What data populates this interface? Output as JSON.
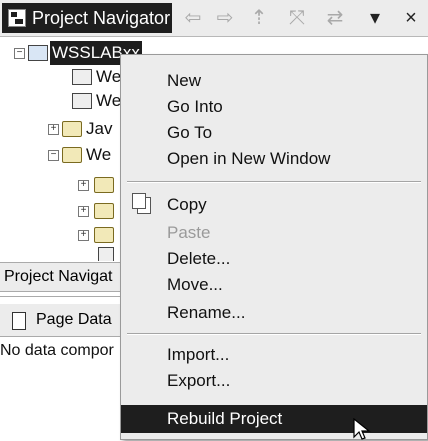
{
  "navigator": {
    "title": "Project Navigator",
    "toolbar": [
      {
        "name": "back-icon",
        "glyph": "⇦"
      },
      {
        "name": "forward-icon",
        "glyph": "⇨"
      },
      {
        "name": "up-icon",
        "glyph": "⇡"
      },
      {
        "name": "collapse-all-icon",
        "glyph": "⤧"
      },
      {
        "name": "link-with-editor-icon",
        "glyph": "⇄"
      },
      {
        "name": "view-menu-icon",
        "glyph": "▾"
      },
      {
        "name": "close-icon",
        "glyph": "×"
      }
    ],
    "tree": [
      {
        "label": "WSSLABxx",
        "selected": true,
        "icon": "project-icon"
      },
      {
        "label": "We",
        "icon": "descriptor-icon"
      },
      {
        "label": "We",
        "icon": "descriptor-icon"
      },
      {
        "label": "Jav",
        "icon": "folder-icon"
      },
      {
        "label": "We",
        "icon": "folder-icon"
      },
      {
        "label": "",
        "icon": "folder-icon"
      },
      {
        "label": "",
        "icon": "folder-icon"
      },
      {
        "label": "",
        "icon": "folder-icon"
      },
      {
        "label": "",
        "icon": "file-icon"
      }
    ]
  },
  "bottom_tabs": {
    "navigator_tab": "Project Navigat",
    "page_data_tab": "Page Data",
    "page_data_empty": "No data compor"
  },
  "context_menu": {
    "items": [
      {
        "label": "New"
      },
      {
        "label": "Go Into"
      },
      {
        "label": "Go To"
      },
      {
        "label": "Open in New Window"
      },
      {
        "label": "Copy",
        "icon": "copy-icon"
      },
      {
        "label": "Paste",
        "disabled": true
      },
      {
        "label": "Delete..."
      },
      {
        "label": "Move..."
      },
      {
        "label": "Rename..."
      },
      {
        "label": "Import..."
      },
      {
        "label": "Export..."
      },
      {
        "label": "Rebuild Project",
        "highlighted": true
      }
    ]
  }
}
